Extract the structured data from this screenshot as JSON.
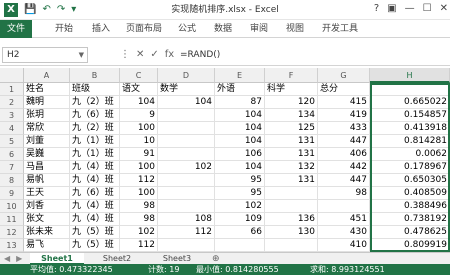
{
  "window": {
    "title": "实现随机排序.xlsx - Excel",
    "controls": [
      "?",
      "▣",
      "—",
      "☐",
      "✕"
    ]
  },
  "quick_access": {
    "logo": "X",
    "save": "💾",
    "undo": "↶",
    "redo": "↷",
    "customize": "▾"
  },
  "ribbon": {
    "file_tab": "文件",
    "tabs": [
      "开始",
      "插入",
      "页面布局",
      "公式",
      "数据",
      "审阅",
      "视图",
      "开发工具"
    ]
  },
  "formula_bar": {
    "name_box": "H2",
    "icons": [
      "⋮",
      "✕",
      "✓",
      "fx"
    ],
    "formula": "=RAND()"
  },
  "columns": [
    "A",
    "B",
    "C",
    "D",
    "E",
    "F",
    "G",
    "H"
  ],
  "rows": [
    {
      "n": "1",
      "cells": [
        "姓名",
        "班级",
        "语文",
        "数学",
        "外语",
        "科学",
        "总分",
        ""
      ]
    },
    {
      "n": "2",
      "cells": [
        "魏明",
        "九（2）班",
        "104",
        "104",
        "87",
        "120",
        "415",
        "0.665022"
      ]
    },
    {
      "n": "3",
      "cells": [
        "张玥",
        "九（6）班",
        "9",
        "",
        "104",
        "134",
        "419",
        "0.154857"
      ]
    },
    {
      "n": "4",
      "cells": [
        "常欣",
        "九（2）班",
        "100",
        "",
        "104",
        "125",
        "433",
        "0.413918"
      ]
    },
    {
      "n": "5",
      "cells": [
        "刘董",
        "九（1）班",
        "10",
        "",
        "104",
        "131",
        "447",
        "0.814281"
      ]
    },
    {
      "n": "6",
      "cells": [
        "吴巍",
        "九（1）班",
        "91",
        "",
        "106",
        "131",
        "406",
        "0.0062"
      ]
    },
    {
      "n": "7",
      "cells": [
        "马昌",
        "九（4）班",
        "100",
        "102",
        "104",
        "132",
        "442",
        "0.178967"
      ]
    },
    {
      "n": "8",
      "cells": [
        "易帆",
        "九（4）班",
        "112",
        "",
        "95",
        "131",
        "447",
        "0.650305"
      ]
    },
    {
      "n": "9",
      "cells": [
        "王天",
        "九（6）班",
        "100",
        "",
        "95",
        "",
        "98",
        "416"
      ]
    },
    {
      "n": "10",
      "cells": [
        "刘香",
        "九（4）班",
        "98",
        "",
        "102",
        "",
        "",
        "0.388496"
      ]
    },
    {
      "n": "11",
      "cells": [
        "张文",
        "九（4）班",
        "98",
        "108",
        "109",
        "136",
        "451",
        "0.738192"
      ]
    },
    {
      "n": "12",
      "cells": [
        "张未来",
        "九（5）班",
        "102",
        "112",
        "66",
        "130",
        "430",
        "0.478625"
      ]
    },
    {
      "n": "13",
      "cells": [
        "易飞",
        "九（5）班",
        "112",
        "",
        "",
        "",
        "410",
        "0.809919"
      ]
    }
  ],
  "h9_value": "0.408509",
  "sheets": {
    "tabs": [
      "Sheet1",
      "Sheet2",
      "Sheet3"
    ],
    "active": "Sheet1",
    "add": "⊕"
  },
  "status_bar": {
    "average": "平均值: 0.473322345",
    "count": "计数: 19",
    "min": "最小值: 0.814280555",
    "sum": "求和: 8.993124551"
  },
  "colors": {
    "accent": "#217346"
  }
}
